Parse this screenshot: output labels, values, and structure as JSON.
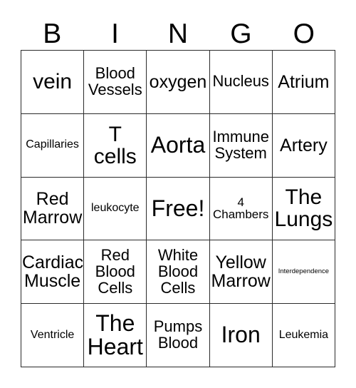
{
  "card": {
    "title": "BINGO",
    "header_letters": [
      "B",
      "I",
      "N",
      "G",
      "O"
    ],
    "free_space_label": "Free!",
    "colors": {
      "background": "#ffffff",
      "grid_line": "#2b2b2b",
      "text": "#000000"
    },
    "rows": [
      [
        {
          "text": "vein",
          "size": "fs-xl"
        },
        {
          "text": "Blood\nVessels",
          "size": "fs-m"
        },
        {
          "text": "oxygen",
          "size": "fs-l"
        },
        {
          "text": "Nucleus",
          "size": "fs-m"
        },
        {
          "text": "Atrium",
          "size": "fs-l"
        }
      ],
      [
        {
          "text": "Capillaries",
          "size": "fs-xxs"
        },
        {
          "text": "T\ncells",
          "size": "fs-xl"
        },
        {
          "text": "Aorta",
          "size": "fs-xxl"
        },
        {
          "text": "Immune\nSystem",
          "size": "fs-m"
        },
        {
          "text": "Artery",
          "size": "fs-l"
        }
      ],
      [
        {
          "text": "Red\nMarrow",
          "size": "fs-l"
        },
        {
          "text": "leukocyte",
          "size": "fs-xxs"
        },
        {
          "text": "Free!",
          "size": "fs-xxl"
        },
        {
          "text": "4\nChambers",
          "size": "fs-xs"
        },
        {
          "text": "The\nLungs",
          "size": "fs-xl"
        }
      ],
      [
        {
          "text": "Cardiac\nMuscle",
          "size": "fs-l"
        },
        {
          "text": "Red\nBlood\nCells",
          "size": "fs-m"
        },
        {
          "text": "White\nBlood\nCells",
          "size": "fs-m"
        },
        {
          "text": "Yellow\nMarrow",
          "size": "fs-l"
        },
        {
          "text": "Interdependence",
          "size": "fs-tiny"
        }
      ],
      [
        {
          "text": "Ventricle",
          "size": "fs-xxs"
        },
        {
          "text": "The\nHeart",
          "size": "fs-xxl"
        },
        {
          "text": "Pumps\nBlood",
          "size": "fs-m"
        },
        {
          "text": "Iron",
          "size": "fs-xxl"
        },
        {
          "text": "Leukemia",
          "size": "fs-xxs"
        }
      ]
    ]
  }
}
